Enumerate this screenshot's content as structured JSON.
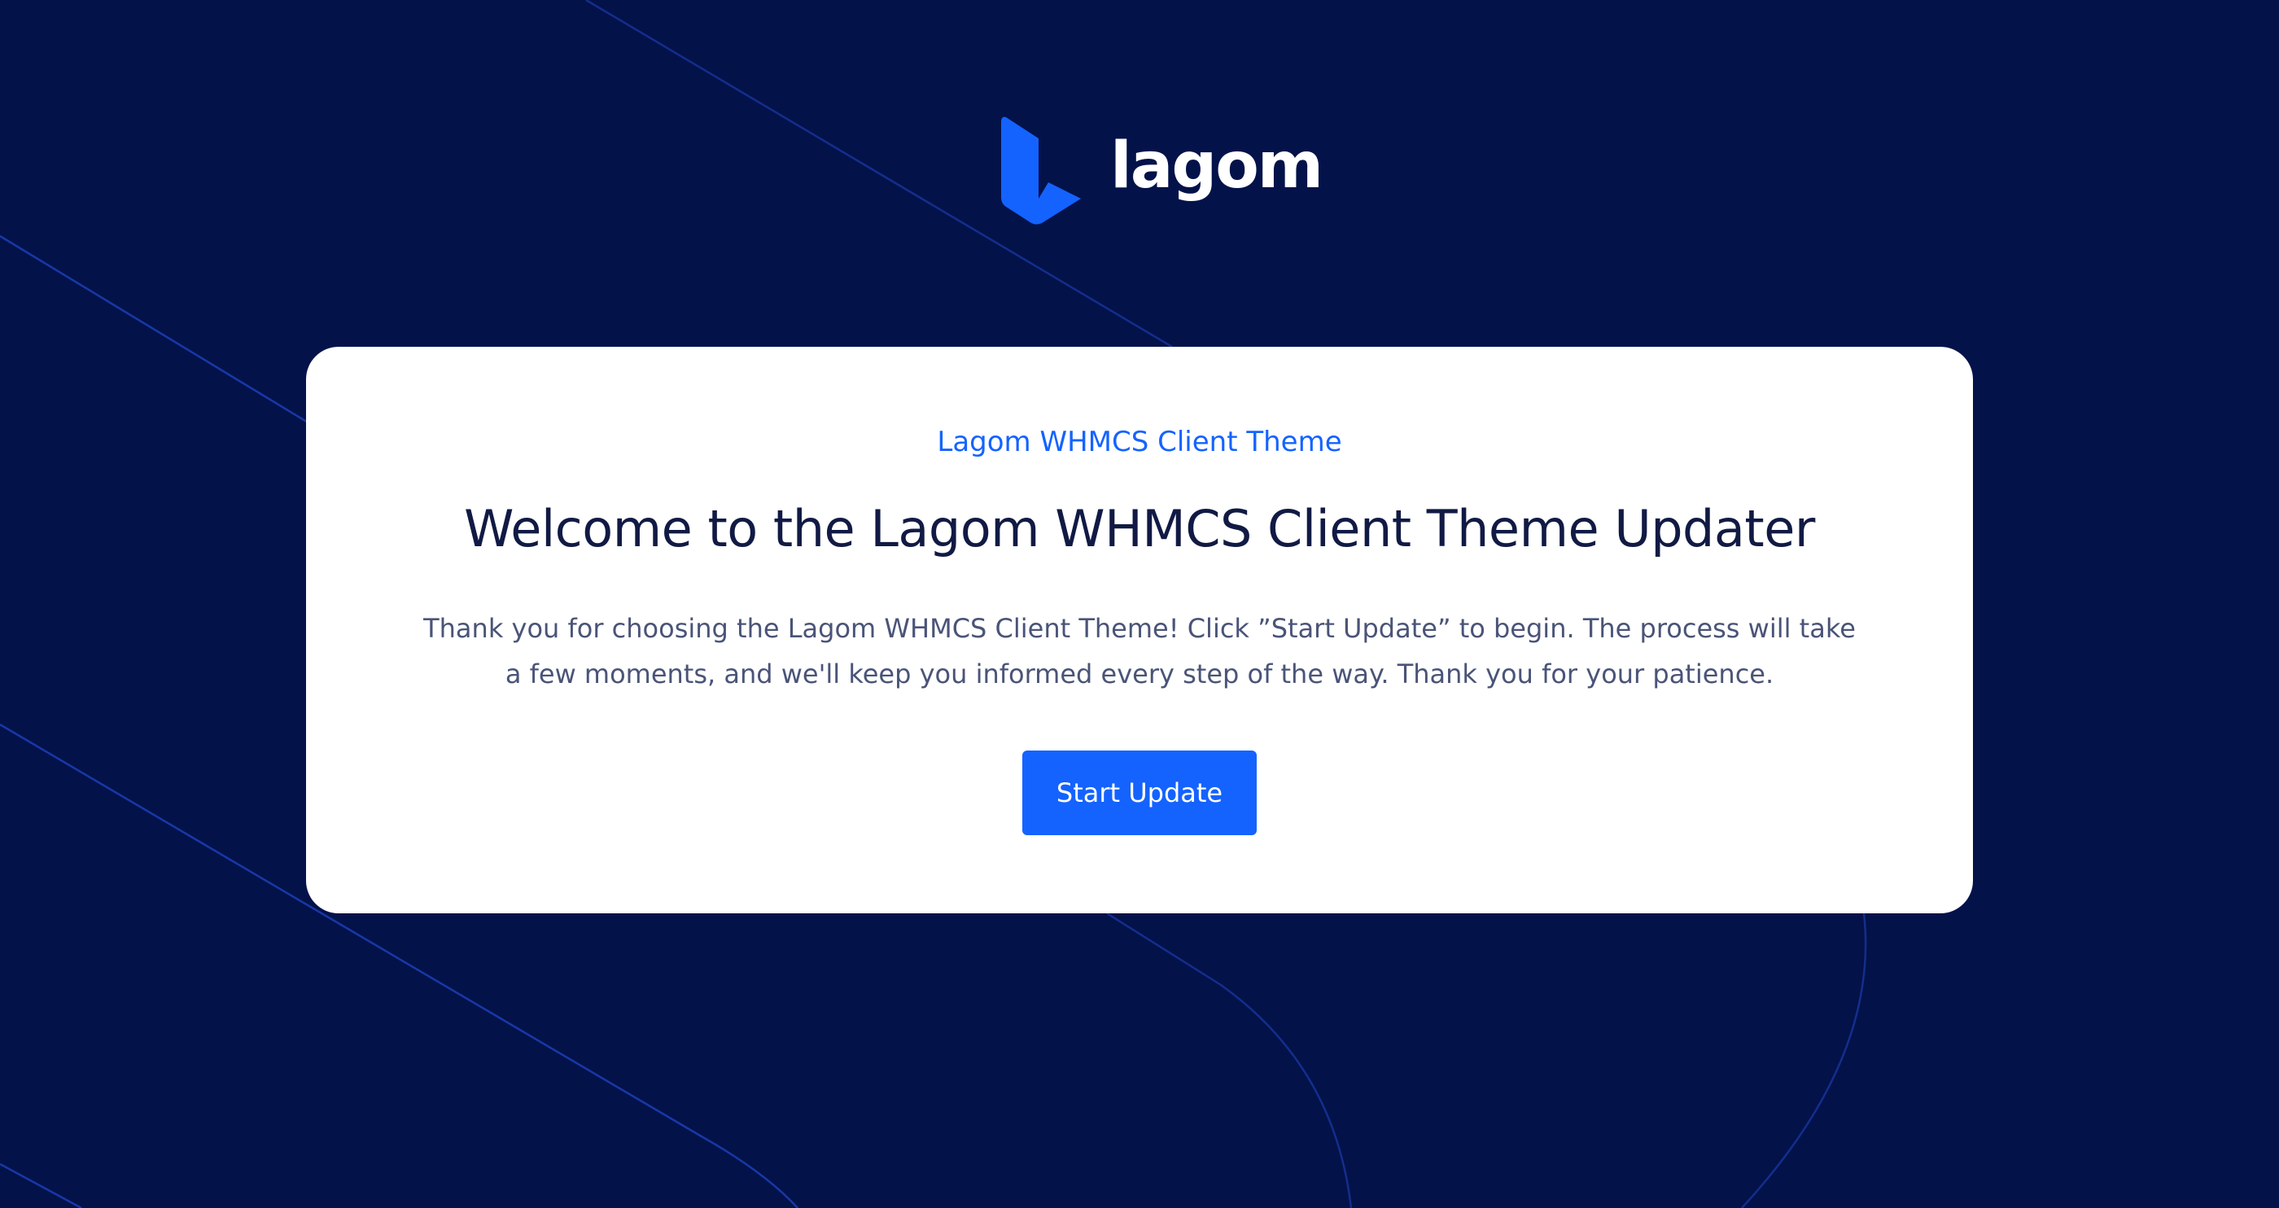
{
  "logo": {
    "text": "lagom",
    "mark_icon": "lagom-logo-icon"
  },
  "card": {
    "eyebrow": "Lagom WHMCS Client Theme",
    "title": "Welcome to the Lagom WHMCS Client Theme Updater",
    "description": "Thank you for choosing the Lagom WHMCS Client Theme! Click ”Start Update” to begin. The process will take a few moments, and we'll keep you informed every step of the way. Thank you for your patience.",
    "button_label": "Start Update"
  },
  "colors": {
    "background": "#04124a",
    "accent": "#1463ff",
    "card": "#ffffff",
    "title": "#111a44",
    "body_text": "#4a5478"
  }
}
